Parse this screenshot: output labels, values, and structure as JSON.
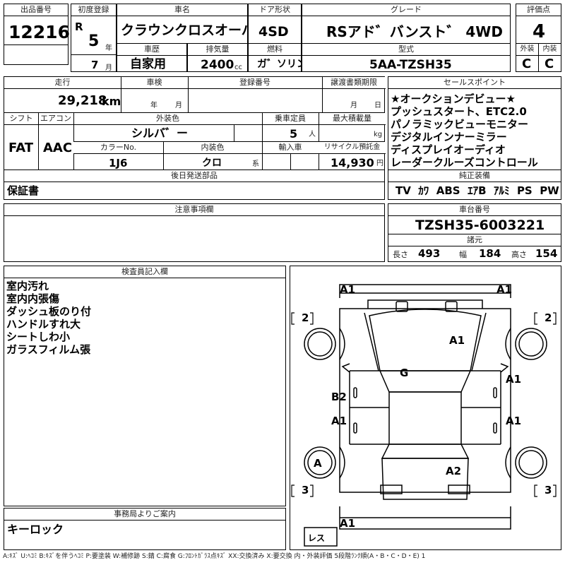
{
  "header": {
    "lot_label": "出品番号",
    "lot_number": "12216",
    "first_reg_label": "初度登録",
    "era": "R",
    "year": "5",
    "year_unit": "年",
    "month": "7",
    "month_unit": "月",
    "car_name_label": "車名",
    "car_name": "クラウンクロスオーバ゛ー",
    "door_label": "ドア形状",
    "door": "4SD",
    "grade_label": "グレード",
    "grade": "RSアド゛バンスト゛ 4WD",
    "score_label": "評価点",
    "score": "4",
    "history_label": "車歴",
    "history": "自家用",
    "displacement_label": "排気量",
    "displacement": "2400",
    "displacement_unit": "cc",
    "fuel_label": "燃料",
    "fuel": "ガ゛ソリン",
    "model_label": "型式",
    "model": "5AA-TZSH35",
    "exterior_label": "外装",
    "exterior": "C",
    "interior_label": "内装",
    "interior": "C"
  },
  "row2": {
    "mileage_label": "走行",
    "mileage": "29,218",
    "mileage_unit": "km",
    "inspection_label": "車検",
    "inspection_year_unit": "年",
    "inspection_month_unit": "月",
    "reg_number_label": "登録番号",
    "transfer_label": "譲渡書類期限",
    "transfer_month_unit": "月",
    "transfer_day_unit": "日",
    "shift_label": "シフト",
    "shift": "FAT",
    "ac_label": "エアコン",
    "ac": "AAC",
    "color_label": "外装色",
    "color": "シルバ゛ー",
    "capacity_label": "乗車定員",
    "capacity": "5",
    "capacity_unit": "人",
    "load_label": "最大積載量",
    "load_unit": "kg",
    "color_no_label": "カラーNo.",
    "color_no": "1J6",
    "int_color_label": "内装色",
    "int_color": "クロ",
    "int_color_unit": "系",
    "import_label": "輸入車",
    "recycle_label": "リサイクル預託金",
    "recycle": "14,930",
    "recycle_unit": "円"
  },
  "sales_points": {
    "label": "セールスポイント",
    "items": [
      "★オークションデビュー★",
      "プッシュスタート、ETC2.0",
      "パノラミックビューモニター",
      "デジタルインナーミラー",
      "ディスプレイオーディオ",
      "レーダークルーズコントロール"
    ]
  },
  "later_parts": {
    "label": "後日発送部品",
    "value": "保証書"
  },
  "equipment": {
    "label": "純正装備",
    "items": [
      "TV",
      "ｶﾜ",
      "ABS",
      "ｴｱB",
      "ｱﾙﾐ",
      "PS",
      "PW"
    ]
  },
  "caution": {
    "label": "注意事項欄"
  },
  "chassis": {
    "label": "車台番号",
    "value": "TZSH35-6003221"
  },
  "dimensions": {
    "label": "諸元",
    "length_label": "長さ",
    "length": "493",
    "width_label": "幅",
    "width": "184",
    "height_label": "高さ",
    "height": "154"
  },
  "inspector": {
    "label": "検査員記入欄",
    "notes": [
      "室内汚れ",
      "室内内張傷",
      "ダッシュ板のり付",
      "ハンドルすれ大",
      "シートしわ小",
      "ガラスフィルム張"
    ]
  },
  "office": {
    "label": "事務局よりご案内",
    "value": "キーロック"
  },
  "diagram": {
    "marks": {
      "front_left": "A1",
      "front_right": "A1",
      "bonnet": "A1",
      "roof": "G",
      "left_front_door": "B2",
      "left_rear_door": "A1",
      "right_front_door": "A1",
      "right_rear_door": "A1",
      "left_rear_wheel": "A",
      "trunk": "A2",
      "rear_bumper": "A1"
    },
    "brackets": {
      "left_upper": "2",
      "right_upper": "2",
      "left_lower": "3",
      "right_lower": "3",
      "rear_label": "レス"
    }
  },
  "legend": "A:ｷｽﾞ U:ﾍｺﾐ B:ｷｽﾞを伴うﾍｺﾐ P:要塗装 W:補修跡 S:錆 C:腐食 G:ﾌﾛﾝﾄｶﾞﾗｽ点ｷｽﾞ XX:交換済み X:要交換 内・外装評価 5段階ﾗﾝｸ順(A・B・C・D・E) 1"
}
